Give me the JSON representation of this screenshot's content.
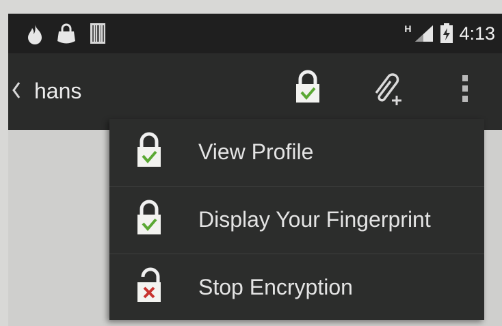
{
  "status_bar": {
    "left_icons": [
      "fire-icon",
      "lock-bag-icon",
      "barcode-icon"
    ],
    "network_label": "H",
    "right_icons": [
      "signal-icon",
      "battery-icon"
    ],
    "time": "4:13"
  },
  "action_bar": {
    "title": "hans",
    "icons": [
      "back-chevron-icon",
      "lock-verified-icon",
      "attach-add-icon",
      "overflow-menu-icon"
    ]
  },
  "menu": {
    "items": [
      {
        "label": "View Profile",
        "icon": "lock-verified-icon"
      },
      {
        "label": "Display Your Fingerprint",
        "icon": "lock-verified-icon"
      },
      {
        "label": "Stop Encryption",
        "icon": "lock-open-error-icon"
      }
    ]
  },
  "colors": {
    "status_bar_bg": "#1f1f1f",
    "action_bar_bg": "#2a2b2a",
    "menu_bg": "#2c2d2c",
    "check_green": "#5aa833",
    "cross_red": "#c7322e"
  }
}
